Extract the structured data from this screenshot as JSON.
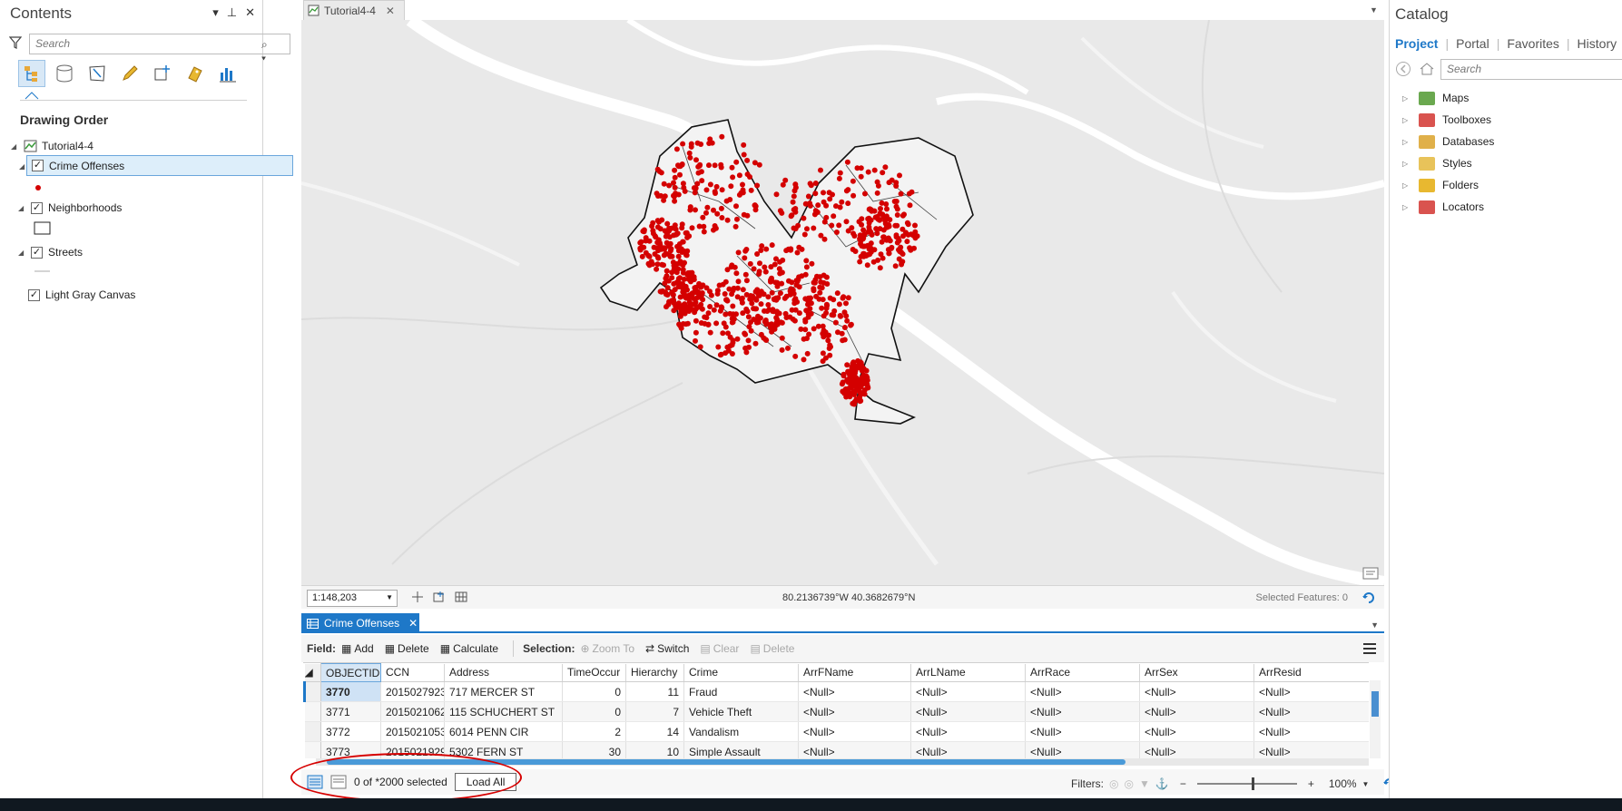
{
  "contents": {
    "title": "Contents",
    "search_placeholder": "Search",
    "heading": "Drawing Order",
    "map_name": "Tutorial4-4",
    "layers": [
      {
        "name": "Crime Offenses",
        "checked": true
      },
      {
        "name": "Neighborhoods",
        "checked": true
      },
      {
        "name": "Streets",
        "checked": true
      },
      {
        "name": "Light Gray Canvas",
        "checked": true
      }
    ]
  },
  "map_view": {
    "tab_label": "Tutorial4-4",
    "scale": "1:148,203",
    "coordinates": "80.2136739°W 40.3682679°N",
    "selected_features": "Selected Features: 0",
    "point_color": "#d40000"
  },
  "table": {
    "tab_label": "Crime Offenses",
    "toolbar": {
      "field_label": "Field:",
      "add": "Add",
      "delete": "Delete",
      "calculate": "Calculate",
      "selection_label": "Selection:",
      "zoom_to": "Zoom To",
      "switch": "Switch",
      "clear": "Clear",
      "delete_sel": "Delete"
    },
    "columns": [
      "OBJECTID",
      "CCN",
      "Address",
      "TimeOccur",
      "Hierarchy",
      "Crime",
      "ArrFName",
      "ArrLName",
      "ArrRace",
      "ArrSex",
      "ArrResid"
    ],
    "rows": [
      [
        "3770",
        "2015027923",
        "717 MERCER ST",
        "0",
        "11",
        "Fraud",
        "<Null>",
        "<Null>",
        "<Null>",
        "<Null>",
        "<Null>"
      ],
      [
        "3771",
        "2015021062",
        "115 SCHUCHERT ST",
        "0",
        "7",
        "Vehicle Theft",
        "<Null>",
        "<Null>",
        "<Null>",
        "<Null>",
        "<Null>"
      ],
      [
        "3772",
        "2015021053",
        "6014 PENN CIR",
        "2",
        "14",
        "Vandalism",
        "<Null>",
        "<Null>",
        "<Null>",
        "<Null>",
        "<Null>"
      ],
      [
        "3773",
        "2015021929",
        "5302 FERN ST",
        "30",
        "10",
        "Simple Assault",
        "<Null>",
        "<Null>",
        "<Null>",
        "<Null>",
        "<Null>"
      ]
    ],
    "footer": {
      "selection_status": "0 of *2000 selected",
      "load_all": "Load All",
      "filters_label": "Filters:",
      "zoom_level": "100%"
    }
  },
  "catalog": {
    "title": "Catalog",
    "tabs": [
      "Project",
      "Portal",
      "Favorites",
      "History"
    ],
    "active_tab": "Project",
    "search_placeholder": "Search",
    "items": [
      {
        "label": "Maps",
        "icon": "maps-icon",
        "color": "#6aa84f"
      },
      {
        "label": "Toolboxes",
        "icon": "toolbox-icon",
        "color": "#d9534f"
      },
      {
        "label": "Databases",
        "icon": "database-icon",
        "color": "#e0b04a"
      },
      {
        "label": "Styles",
        "icon": "styles-icon",
        "color": "#e8c35a"
      },
      {
        "label": "Folders",
        "icon": "folder-icon",
        "color": "#e8b830"
      },
      {
        "label": "Locators",
        "icon": "locator-icon",
        "color": "#d9534f"
      }
    ]
  }
}
